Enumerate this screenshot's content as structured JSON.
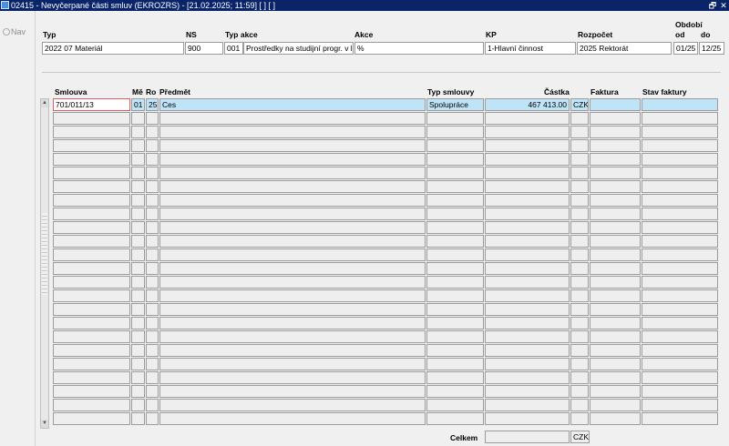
{
  "window": {
    "title": "02415 - Nevyčerpané části smluv (EKROZRS) - [21.02.2025; 11:59]  [ ]  [ ]",
    "restore_glyph": "🗗",
    "close_glyph": "✕"
  },
  "nav": {
    "label": "Nav"
  },
  "header": {
    "labels": {
      "typ": "Typ",
      "ns": "NS",
      "typ_akce": "Typ akce",
      "akce": "Akce",
      "kp": "KP",
      "rozpocet": "Rozpočet",
      "obdobi": "Období",
      "od": "od",
      "do": "do"
    },
    "values": {
      "typ": "2022 07 Materiál",
      "ns": "900",
      "typ_akce": "001",
      "typ_akce_popis": "Prostředky na studijní progr. v l",
      "akce": "%",
      "kp": "1-Hlavní činnost",
      "rozpocet": "2025 Rektorát",
      "od": "01/25",
      "do": "12/25"
    }
  },
  "table": {
    "columns": {
      "smlouva": "Smlouva",
      "me": "Mě",
      "ro": "Ro",
      "predmet": "Předmět",
      "typ_smlouvy": "Typ smlouvy",
      "castka": "Částka",
      "faktura": "Faktura",
      "stav_faktury": "Stav faktury"
    },
    "rows": [
      {
        "smlouva": "701/011/13",
        "me": "01",
        "ro": "25",
        "predmet": "Ces",
        "typ_smlouvy": "Spolupráce",
        "castka": "467 413.00",
        "mena": "CZK",
        "faktura": "",
        "stav_faktury": ""
      }
    ],
    "row_count": 24
  },
  "footer": {
    "celkem_label": "Celkem",
    "celkem_value": "",
    "mena": "CZK"
  }
}
